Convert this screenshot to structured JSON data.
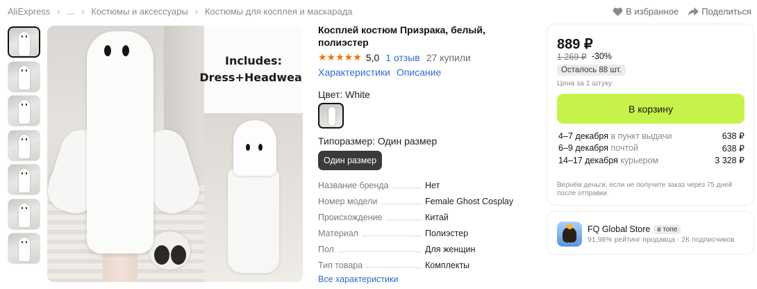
{
  "breadcrumb": [
    "AliExpress",
    "...",
    "Костюмы и аксессуары",
    "Костюмы для косплея и маскарада"
  ],
  "actions": {
    "favorite": "В избранное",
    "share": "Поделиться"
  },
  "gallery": {
    "thumb_count": 7,
    "main_image_caption_line1": "Includes:",
    "main_image_caption_line2": "Dress+Headwear"
  },
  "product": {
    "title": "Косплей костюм Призрака, белый, полиэстер",
    "stars": "★★★★★",
    "rating": "5,0",
    "reviews": "1 отзыв",
    "bought": "27 купили",
    "tab_specs": "Характеристики",
    "tab_description": "Описание",
    "color_label": "Цвет: White",
    "size_label": "Типоразмер: Один размер",
    "size_option": "Один размер",
    "specs": [
      {
        "k": "Название бренда",
        "v": "Нет"
      },
      {
        "k": "Номер модели",
        "v": "Female Ghost Cosplay"
      },
      {
        "k": "Происхождение",
        "v": "Китай"
      },
      {
        "k": "Материал",
        "v": "Полиэстер"
      },
      {
        "k": "Пол",
        "v": "Для женщин"
      },
      {
        "k": "Тип товара",
        "v": "Комплекты"
      }
    ],
    "all_specs_link": "Все характеристики"
  },
  "buy": {
    "price": "889 ₽",
    "old_price": "1 269 ₽",
    "discount": "-30%",
    "stock": "Осталось 88 шт.",
    "unit_note": "Цена за 1 штуку",
    "cart_button": "В корзину",
    "delivery": [
      {
        "date": "4–7 декабря",
        "how": "в пункт выдачи",
        "cost": "638 ₽"
      },
      {
        "date": "6–9 декабря",
        "how": "почтой",
        "cost": "638 ₽"
      },
      {
        "date": "14–17 декабря",
        "how": "курьером",
        "cost": "3 328 ₽"
      }
    ],
    "refund_note": "Вернём деньги, если не получите заказ через 75 дней после отправки."
  },
  "store": {
    "name": "FQ Global Store",
    "badge": "в топе",
    "meta": "91,98% рейтинг продавца · 2К подписчиков"
  },
  "colors": {
    "accent": "#2d6bd6",
    "cart": "#c7f24a",
    "stars": "#ff6a00"
  }
}
